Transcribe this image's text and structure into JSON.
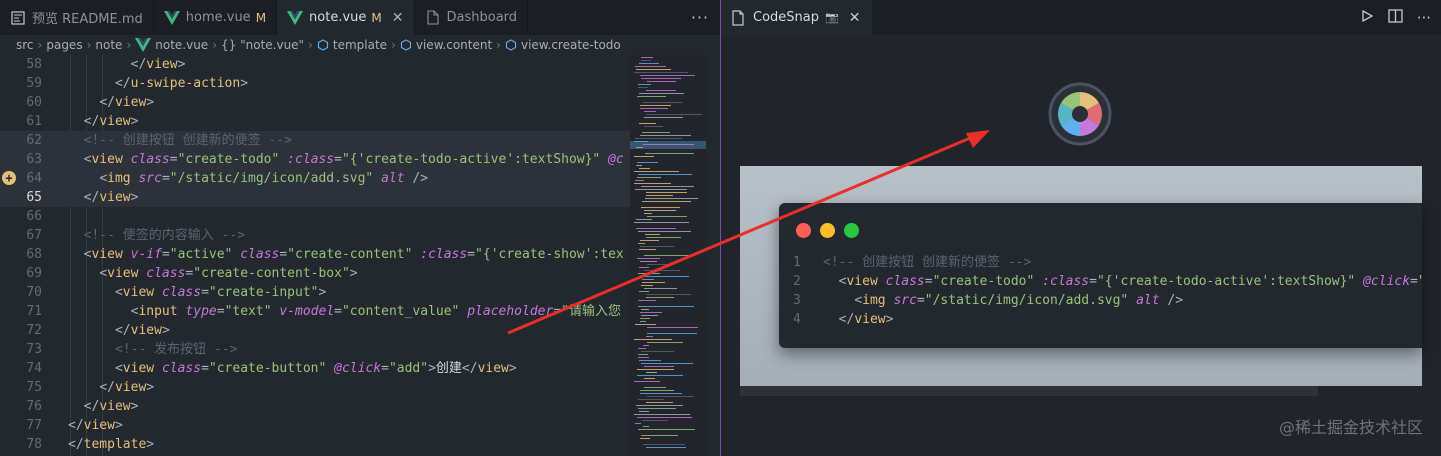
{
  "tabs": [
    {
      "label": "预览 README.md",
      "icon": "preview-icon",
      "modified": "",
      "active": false
    },
    {
      "label": "home.vue",
      "icon": "vue-icon",
      "modified": "M",
      "active": false
    },
    {
      "label": "note.vue",
      "icon": "vue-icon",
      "modified": "M",
      "active": true
    },
    {
      "label": "Dashboard",
      "icon": "file-icon",
      "modified": "",
      "active": false
    }
  ],
  "tab_more": "···",
  "breadcrumbs": [
    "src",
    "pages",
    "note",
    "note.vue",
    "{} \"note.vue\"",
    "template",
    "view.content",
    "view.create-todo"
  ],
  "code_lines": [
    {
      "n": "58",
      "text": "        </view>"
    },
    {
      "n": "59",
      "text": "      </u-swipe-action>"
    },
    {
      "n": "60",
      "text": "    </view>"
    },
    {
      "n": "61",
      "text": "  </view>"
    },
    {
      "n": "62",
      "text": "  <!-- 创建按钮 创建新的便签 -->"
    },
    {
      "n": "63",
      "text": "  <view class=\"create-todo\" :class=\"{'create-todo-active':textShow}\" @c"
    },
    {
      "n": "64",
      "text": "    <img src=\"/static/img/icon/add.svg\" alt />"
    },
    {
      "n": "65",
      "text": "  </view>"
    },
    {
      "n": "66",
      "text": ""
    },
    {
      "n": "67",
      "text": "  <!-- 便签的内容输入 -->"
    },
    {
      "n": "68",
      "text": "  <view v-if=\"active\" class=\"create-content\" :class=\"{'create-show':tex"
    },
    {
      "n": "69",
      "text": "    <view class=\"create-content-box\">"
    },
    {
      "n": "70",
      "text": "      <view class=\"create-input\">"
    },
    {
      "n": "71",
      "text": "        <input type=\"text\" v-model=\"content_value\" placeholder=\"请输入您"
    },
    {
      "n": "72",
      "text": "      </view>"
    },
    {
      "n": "73",
      "text": "      <!-- 发布按钮 -->"
    },
    {
      "n": "74",
      "text": "      <view class=\"create-button\" @click=\"add\">创建</view>"
    },
    {
      "n": "75",
      "text": "    </view>"
    },
    {
      "n": "76",
      "text": "  </view>"
    },
    {
      "n": "77",
      "text": "</view>"
    },
    {
      "n": "78",
      "text": "</template>"
    }
  ],
  "codesnap": {
    "tab_label": "CodeSnap",
    "tab_badge": "📷",
    "snippet": [
      {
        "n": "1",
        "text": "<!-- 创建按钮 创建新的便签 -->"
      },
      {
        "n": "2",
        "text": "  <view class=\"create-todo\" :class=\"{'create-todo-active':textShow}\" @click=\"c"
      },
      {
        "n": "3",
        "text": "    <img src=\"/static/img/icon/add.svg\" alt />"
      },
      {
        "n": "4",
        "text": "  </view>"
      }
    ],
    "window_dot_colors": [
      "#ff5f57",
      "#febc2e",
      "#28c840"
    ]
  },
  "watermark": "@稀土掘金技术社区",
  "colors": {
    "accent_divider": "#7c4dae",
    "arrow": "#e8302a",
    "vue_green": "#41b883",
    "modified": "#e2c08d"
  }
}
